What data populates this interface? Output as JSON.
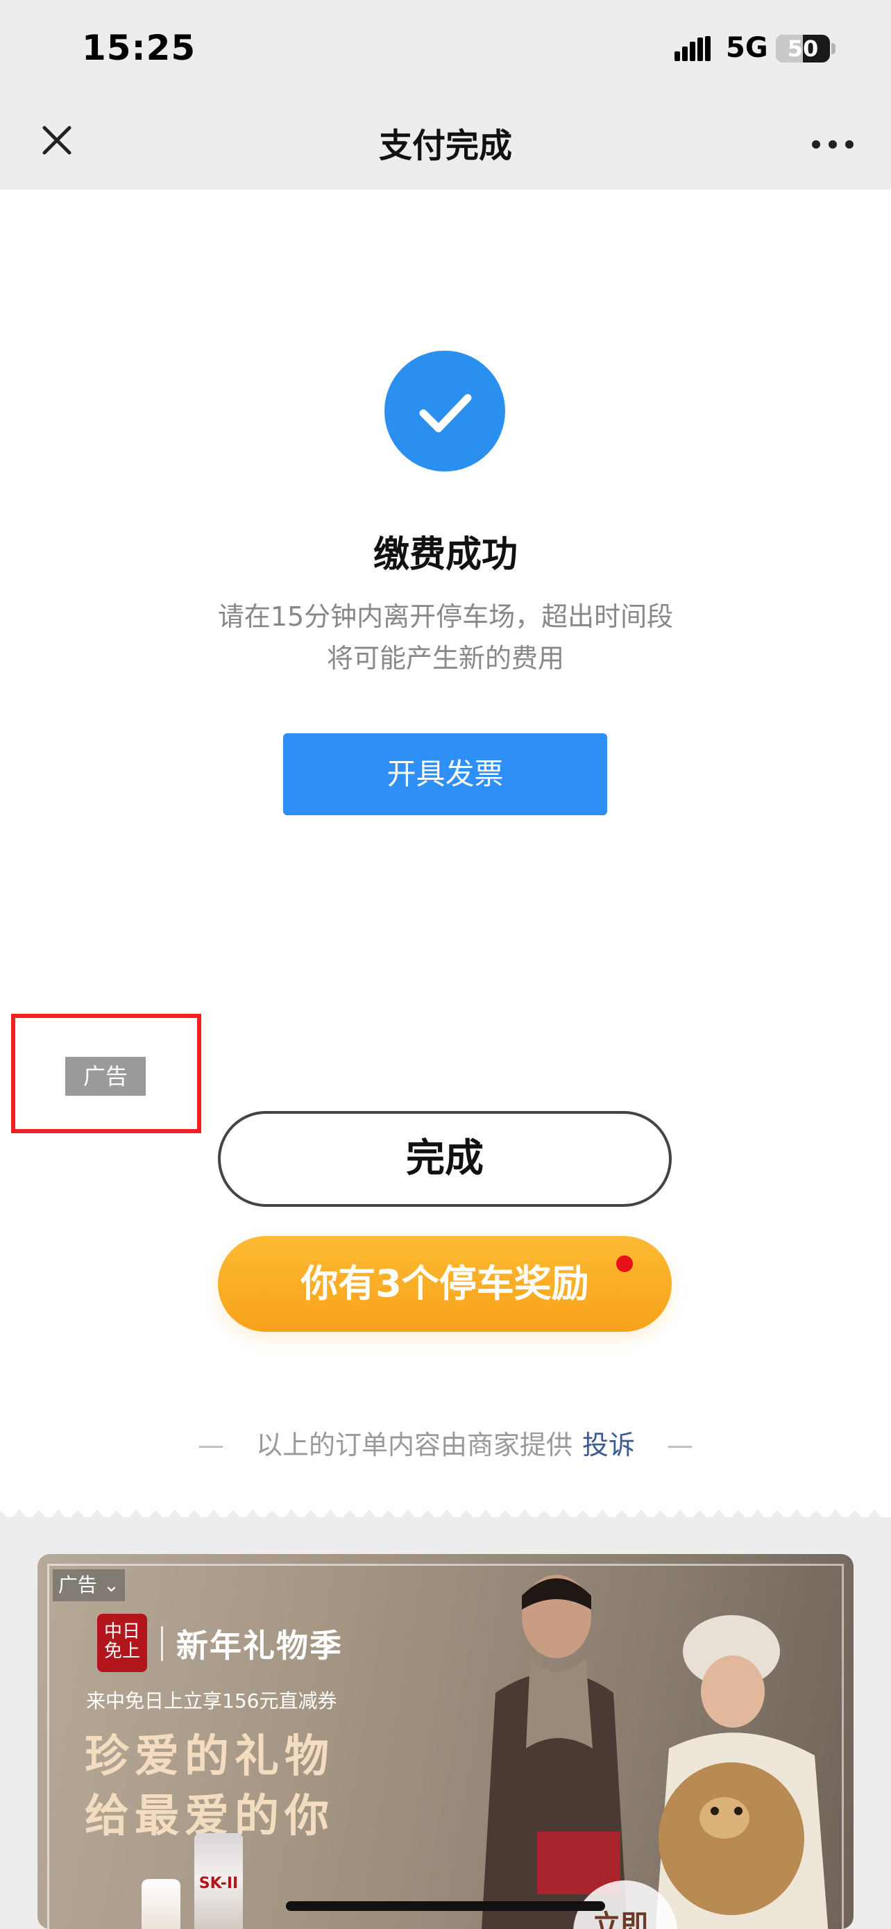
{
  "status_bar": {
    "time": "15:25",
    "network": "5G",
    "battery_level": "50",
    "battery_fraction": 0.5
  },
  "nav": {
    "title": "支付完成",
    "close_icon": "close-icon",
    "more_icon": "more-dots-icon"
  },
  "result": {
    "icon": "check-icon",
    "title": "缴费成功",
    "notice_line1": "请在15分钟内离开停车场，超出时间段",
    "notice_line2": "将可能产生新的费用",
    "invoice_label": "开具发票"
  },
  "ad_tag": "广告",
  "actions": {
    "done_label": "完成",
    "reward_label": "你有3个停车奖励"
  },
  "footer": {
    "merchant_text": "以上的订单内容由商家提供",
    "complain_label": "投诉",
    "dash": "—"
  },
  "banner": {
    "ad_tag": "广告",
    "seal_text": "中日免上",
    "brand_title": "新年礼物季",
    "promo_line": "来中免日上立享156元直减券",
    "slogan_line1": "珍爱的礼物",
    "slogan_line2": "给最爱的你",
    "bottle_label": "SK-II",
    "cta_label": "立即"
  },
  "colors": {
    "primary_blue": "#2e8ff6",
    "reward_orange": "#f8a21b",
    "highlight_red": "#f22020",
    "link_blue": "#3b5a93"
  }
}
